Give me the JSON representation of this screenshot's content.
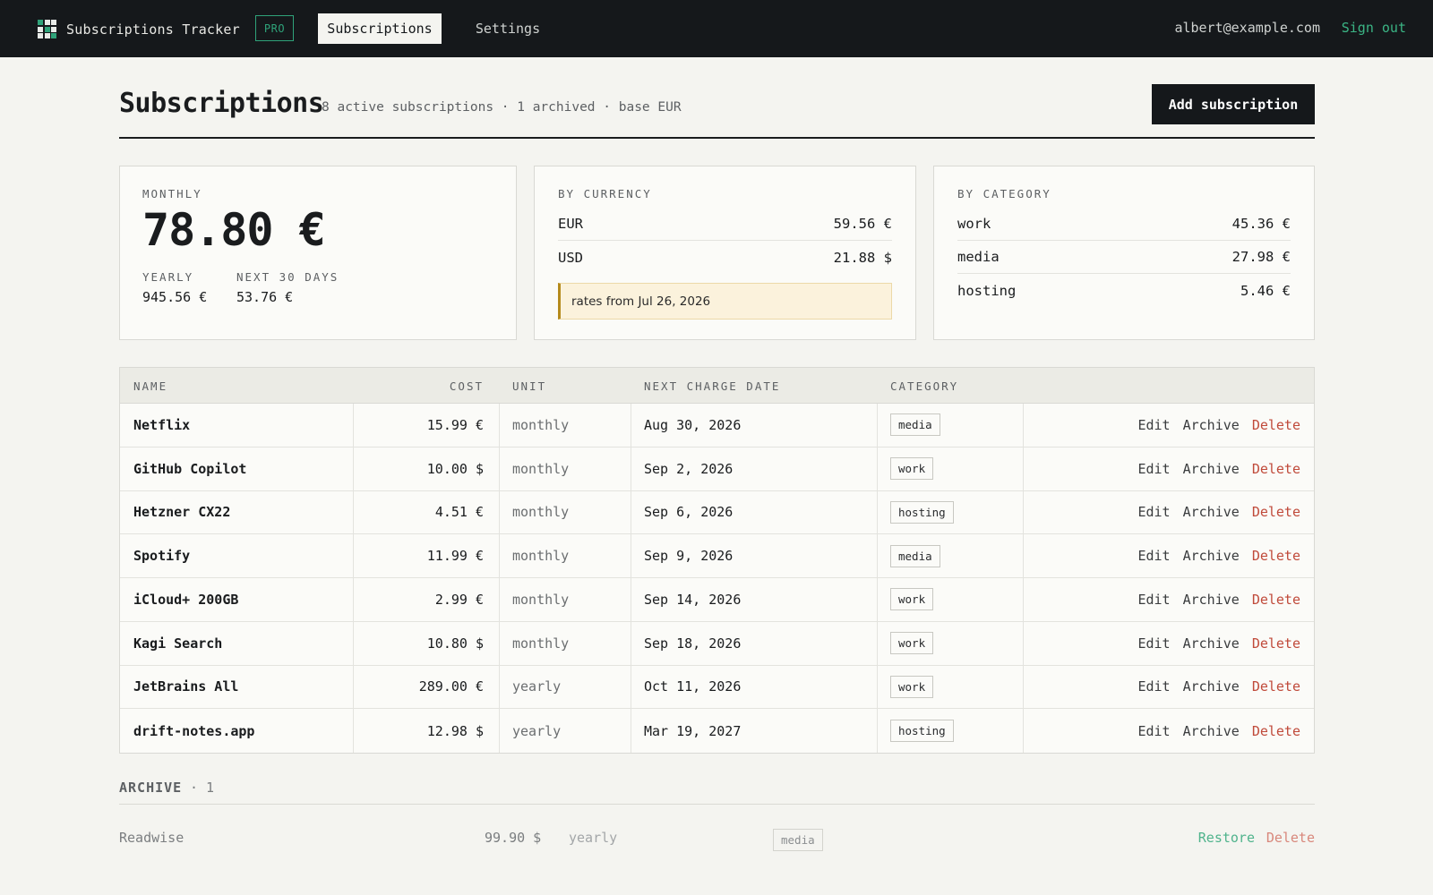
{
  "nav": {
    "app_name": "Subscriptions Tracker",
    "badge": "PRO",
    "tabs": [
      {
        "label": "Subscriptions",
        "active": true
      },
      {
        "label": "Settings",
        "active": false
      }
    ],
    "user_email": "albert@example.com",
    "sign_out": "Sign out"
  },
  "header": {
    "title": "Subscriptions",
    "subtitle": "8 active subscriptions · 1 archived · base EUR",
    "add_button": "Add subscription"
  },
  "summary": {
    "monthly_label": "MONTHLY",
    "monthly_total": "78.80 €",
    "yearly_label": "YEARLY",
    "yearly_total": "945.56 €",
    "next30_label": "NEXT 30 DAYS",
    "next30_total": "53.76 €"
  },
  "by_currency": {
    "label": "BY CURRENCY",
    "rows": [
      {
        "key": "EUR",
        "value": "59.56 €"
      },
      {
        "key": "USD",
        "value": "21.88 $"
      }
    ],
    "note": "rates from Jul 26, 2026"
  },
  "by_category": {
    "label": "BY CATEGORY",
    "rows": [
      {
        "key": "work",
        "value": "45.36 €"
      },
      {
        "key": "media",
        "value": "27.98 €"
      },
      {
        "key": "hosting",
        "value": "5.46 €"
      }
    ]
  },
  "table": {
    "headers": {
      "name": "NAME",
      "cost": "COST",
      "unit": "UNIT",
      "date": "NEXT CHARGE DATE",
      "category": "CATEGORY"
    },
    "actions": {
      "edit": "Edit",
      "archive": "Archive",
      "delete": "Delete"
    },
    "rows": [
      {
        "name": "Netflix",
        "cost": "15.99 €",
        "unit": "monthly",
        "date": "Aug 30, 2026",
        "category": "media"
      },
      {
        "name": "GitHub Copilot",
        "cost": "10.00 $",
        "unit": "monthly",
        "date": "Sep 2, 2026",
        "category": "work"
      },
      {
        "name": "Hetzner CX22",
        "cost": "4.51 €",
        "unit": "monthly",
        "date": "Sep 6, 2026",
        "category": "hosting"
      },
      {
        "name": "Spotify",
        "cost": "11.99 €",
        "unit": "monthly",
        "date": "Sep 9, 2026",
        "category": "media"
      },
      {
        "name": "iCloud+ 200GB",
        "cost": "2.99 €",
        "unit": "monthly",
        "date": "Sep 14, 2026",
        "category": "work"
      },
      {
        "name": "Kagi Search",
        "cost": "10.80 $",
        "unit": "monthly",
        "date": "Sep 18, 2026",
        "category": "work"
      },
      {
        "name": "JetBrains All",
        "cost": "289.00 €",
        "unit": "yearly",
        "date": "Oct 11, 2026",
        "category": "work"
      },
      {
        "name": "drift-notes.app",
        "cost": "12.98 $",
        "unit": "yearly",
        "date": "Mar 19, 2027",
        "category": "hosting"
      }
    ]
  },
  "archive": {
    "label": "ARCHIVE",
    "count": "· 1",
    "items": [
      {
        "name": "Readwise",
        "cost": "99.90 $",
        "unit": "yearly",
        "category": "media",
        "restore": "Restore",
        "delete": "Delete"
      }
    ]
  },
  "colors": {
    "accent": "#2fa37a",
    "danger": "#c04a3a",
    "nav_bg": "#15181b",
    "page_bg": "#f4f4f0"
  }
}
